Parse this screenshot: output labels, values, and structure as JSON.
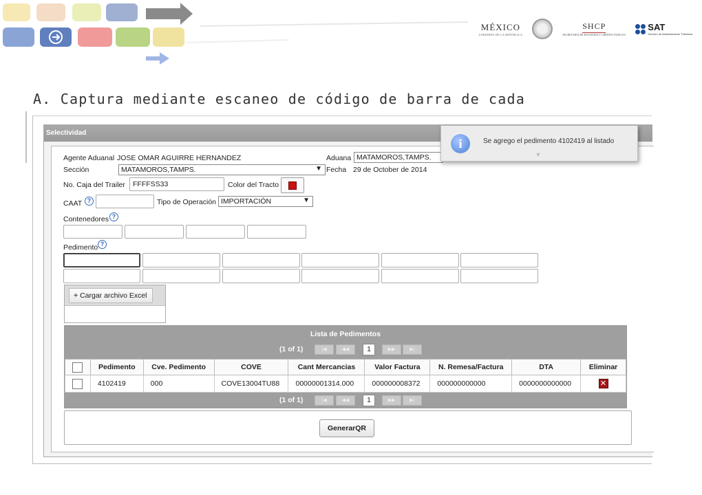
{
  "header": {
    "mexico_title": "MÉXICO",
    "mexico_sub": "GOBIERNO DE LA REPÚBLICA",
    "shcp_title": "SHCP",
    "shcp_sub": "SECRETARÍA DE HACIENDA Y CRÉDITO PÚBLICO",
    "sat_title": "SAT",
    "sat_sub": "Servicio de Administración Tributaria"
  },
  "slide": {
    "heading": "A. Captura mediante escaneo de código de barra de cada"
  },
  "panel": {
    "title": "Selectividad"
  },
  "form": {
    "agente_label": "Agente Aduanal",
    "agente_value": "JOSE OMAR AGUIRRE HERNANDEZ",
    "aduana_label": "Aduana",
    "aduana_value": "MATAMOROS,TAMPS.",
    "seccion_label": "Sección",
    "seccion_value": "MATAMOROS,TAMPS.",
    "fecha_label": "Fecha",
    "fecha_value": "29 de October de 2014",
    "caja_label": "No. Caja del Trailer",
    "caja_value": "FFFFSS33",
    "color_label": "Color del Tracto",
    "caat_label": "CAAT",
    "caat_value": "",
    "tipo_label": "Tipo de Operación",
    "tipo_value": "IMPORTACIÓN",
    "contenedores_label": "Contenedores",
    "pedimento_label": "Pedimento",
    "excel_button": "Cargar archivo Excel"
  },
  "grid": {
    "title": "Lista de Pedimentos",
    "page_info": "(1 of 1)",
    "page_current": "1",
    "columns": [
      "Pedimento",
      "Cve. Pedimento",
      "COVE",
      "Cant Mercancias",
      "Valor Factura",
      "N. Remesa/Factura",
      "DTA",
      "Eliminar"
    ],
    "rows": [
      {
        "pedimento": "4102419",
        "cve": "000",
        "cove": "COVE13004TU88",
        "cant": "00000001314.000",
        "valor": "000000008372",
        "remesa": "000000000000",
        "dta": "0000000000000"
      }
    ]
  },
  "actions": {
    "generar_qr": "GenerarQR"
  },
  "toast": {
    "message": "Se agrego el pedimento 4102419 al listado"
  },
  "colors": {
    "tracto_color": "#cc1111",
    "panel_header": "#9f9f9f",
    "accent_blue": "#3366bb"
  }
}
